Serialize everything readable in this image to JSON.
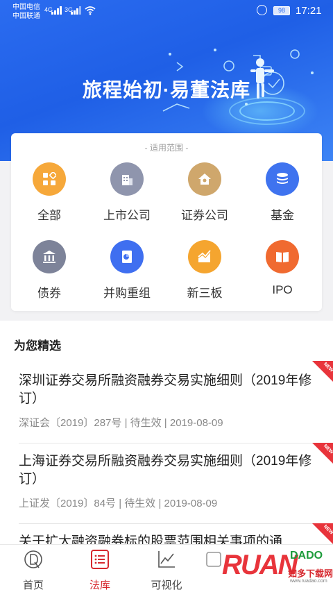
{
  "status_bar": {
    "carrier1": "中国电信",
    "carrier2": "中国联通",
    "net1": "4G",
    "net2": "3G",
    "battery": "98",
    "time": "17:21"
  },
  "hero": {
    "title": "旅程始初·易董法库"
  },
  "scope": {
    "label": "- 适用范围 -",
    "categories": [
      {
        "label": "全部",
        "icon": "grid-icon",
        "color": "#f6a83a"
      },
      {
        "label": "上市公司",
        "icon": "building-icon",
        "color": "#8f95ad"
      },
      {
        "label": "证券公司",
        "icon": "house-icon",
        "color": "#cfa76c"
      },
      {
        "label": "基金",
        "icon": "coins-stack-icon",
        "color": "#3f73ef"
      },
      {
        "label": "债券",
        "icon": "bank-icon",
        "color": "#7d8399"
      },
      {
        "label": "并购重组",
        "icon": "document-icon",
        "color": "#3f6ff0"
      },
      {
        "label": "新三板",
        "icon": "trend-chart-icon",
        "color": "#f5a52f"
      },
      {
        "label": "IPO",
        "icon": "book-icon",
        "color": "#f06a30"
      }
    ]
  },
  "picks": {
    "title": "为您精选",
    "badge": "NEW",
    "items": [
      {
        "title": "深圳证券交易所融资融券交易实施细则（2019年修订）",
        "meta": "深证会〔2019〕287号 | 待生效 | 2019-08-09"
      },
      {
        "title": "上海证券交易所融资融券交易实施细则（2019年修订）",
        "meta": "上证发〔2019〕84号 | 待生效 | 2019-08-09"
      },
      {
        "title": "关于扩大融资融券标的股票范围相关事项的通",
        "meta": ""
      }
    ]
  },
  "nav": {
    "tabs": [
      {
        "label": "首页"
      },
      {
        "label": "法库"
      },
      {
        "label": "可视化"
      }
    ]
  },
  "watermark": {
    "logo": "RUAN",
    "brand": "DADO",
    "cn": "如多下载网",
    "url": "www.ruadao.com"
  },
  "colors": {
    "accent": "#d6282e",
    "hero_blue": "#2b6cf0"
  }
}
